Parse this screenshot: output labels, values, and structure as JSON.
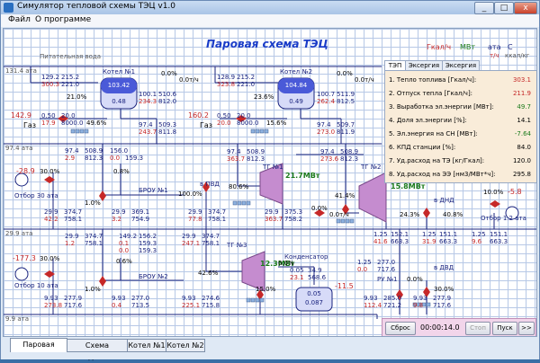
{
  "window": {
    "title": "Симулятор тепловой схемы ТЭЦ v1.0",
    "btn_min": "_",
    "btn_max": "□",
    "btn_close": "x"
  },
  "menu": {
    "file": "Файл",
    "about": "О программе"
  },
  "scheme": {
    "title": "Паровая схема ТЭЦ",
    "feedwater": "Питательная вода",
    "units": {
      "gkal": "Гкал/ч",
      "mw": "МВт",
      "ata": "ата",
      "c": "С",
      "th": "т/ч",
      "kkal": "ккал/кг"
    },
    "levels": {
      "l131": "131.4 ата",
      "l97": "97.4 ата",
      "l29": "29.9 ата",
      "l9": "9.9 ата"
    },
    "boiler1": {
      "label": "Котел №1",
      "top": "103.42",
      "bottom": "0.48",
      "pct": "21.0%",
      "pct2": "49.6%",
      "flow": "0.0т/ч",
      "flow_pct": "0.0%",
      "in_top": [
        "129.2",
        "215.2"
      ],
      "in_bot": [
        "300.3",
        "221.0"
      ],
      "out_top": [
        "100.1",
        "510.6"
      ],
      "out_bot": [
        "234.3",
        "812.0"
      ],
      "gas": [
        "0.50",
        "20.0"
      ],
      "gas2": [
        "17.9",
        "8000.0"
      ],
      "gas_label": "Газ",
      "gas_temp": "142.9",
      "st_top": [
        "97.4",
        "509.3"
      ],
      "st_bot": [
        "243.7",
        "811.8"
      ]
    },
    "boiler2": {
      "label": "Котел №2",
      "top": "104.84",
      "bottom": "0.49",
      "pct": "23.6%",
      "pct2": "15.6%",
      "flow": "0.0т/ч",
      "flow_pct": "0.0%",
      "in_top": [
        "128.9",
        "215.2"
      ],
      "in_bot": [
        "323.8",
        "221.0"
      ],
      "out_top": [
        "100.7",
        "511.9"
      ],
      "out_bot": [
        "262.4",
        "812.5"
      ],
      "gas": [
        "0.50",
        "20.0"
      ],
      "gas2": [
        "20.0",
        "8000.0"
      ],
      "gas_label": "Газ",
      "gas_temp": "160.2",
      "st_top": [
        "97.4",
        "509.7"
      ],
      "st_bot": [
        "273.0",
        "811.9"
      ]
    },
    "broy1": {
      "label": "БРОУ №1",
      "pct": "0.8%",
      "pct2": "1.0%",
      "top": [
        "97.4",
        "508.9",
        "156.0"
      ],
      "bot": [
        "2.9",
        "812.3",
        "159.3"
      ],
      "small": [
        "0.0",
        "159.3"
      ],
      "out_top": [
        "29.9",
        "369.1"
      ],
      "out_bot": [
        "3.2",
        "754.9"
      ]
    },
    "broy2": {
      "label": "БРОУ №2",
      "pct": "0.6%",
      "pct2": "1.0%",
      "top": [
        "149.2",
        "156.2"
      ],
      "bot": [
        "0.1",
        "159.3"
      ],
      "small": [
        "0.0",
        "159.3"
      ],
      "out_top": [
        "9.93",
        "277.0"
      ],
      "out_bot": [
        "0.4",
        "713.5"
      ]
    },
    "otbor30": {
      "label": "Отбор 30 ата",
      "temp": "-28.9",
      "pct": "30.0%",
      "top": [
        "29.9",
        "374.7"
      ],
      "bot": [
        "42.2",
        "758.1"
      ]
    },
    "otbor10": {
      "label": "Отбор 10 ата",
      "temp": "-177.3",
      "pct": "30.0%",
      "top": [
        "29.9",
        "374.7"
      ],
      "bot": [
        "1.2",
        "758.1"
      ],
      "out_top": [
        "9.93",
        "277.9"
      ],
      "out_bot": [
        "273.8",
        "717.6"
      ]
    },
    "tg1": {
      "label": "ТГ №1",
      "power": "21.7МВт",
      "pct": "80.6%",
      "pvd_pct": "100.0%",
      "pvd_label": "в ПВД",
      "in_top": [
        "97.4",
        "508.9"
      ],
      "in_bot": [
        "363.7",
        "812.3"
      ],
      "pvd_top": [
        "29.9",
        "374.7"
      ],
      "pvd_bot": [
        "77.8",
        "758.1"
      ],
      "out_top": [
        "29.9",
        "375.3"
      ],
      "out_bot": [
        "363.7",
        "758.2"
      ],
      "flow_pct": "0.0%",
      "flow": "0.0т/ч"
    },
    "tg2": {
      "label": "ТГ №2",
      "power": "15.8МВт",
      "pct": "41.4%",
      "pct2": "24.3%",
      "in_top": [
        "97.4",
        "508.9"
      ],
      "in_bot": [
        "273.6",
        "812.3"
      ],
      "mid_top": [
        "1.25",
        "152.1"
      ],
      "mid_bot": [
        "41.6",
        "663.3"
      ],
      "dnd_label": "в ДНД",
      "dnd_pct": "40.8%",
      "dnd_top": [
        "1.25",
        "151.1"
      ],
      "dnd_bot": [
        "31.9",
        "663.3"
      ],
      "o12_label": "Отбор 1.2 ата",
      "o12_pct": "10.0%",
      "o12_temp": "-5.8",
      "o12_top": [
        "1.25",
        "151.1"
      ],
      "o12_bot": [
        "9.6",
        "663.3"
      ]
    },
    "tg3": {
      "label": "ТГ №3",
      "power": "12.3МВт",
      "pct": "42.6%",
      "pct2": "15.0%",
      "in_top": [
        "29.9",
        "374.7"
      ],
      "in_bot": [
        "247.1",
        "758.1"
      ],
      "out_top": [
        "9.93",
        "274.6"
      ],
      "out_bot": [
        "225.1",
        "715.8"
      ],
      "kond_label": "Конденсатор",
      "kond_pct": "0.0%",
      "kond_top": [
        "0.05",
        "34.9"
      ],
      "kond_bot": [
        "23.1",
        "568.6"
      ],
      "kond_temp": "-11.5",
      "kond_box_top": "0.05",
      "kond_box_bot": "0.087"
    },
    "ru1": {
      "label": "РУ №1",
      "pct": "0.0%",
      "top": [
        "1.25",
        "277.0"
      ],
      "bot": [
        "0.0",
        "717.6"
      ],
      "in_top": [
        "9.93",
        "285.0"
      ],
      "in_bot": [
        "112.4",
        "721.2"
      ]
    },
    "dvd": {
      "label": "в ДВД",
      "pct": "30.0%",
      "top": [
        "9.93",
        "277.9"
      ],
      "bot": [
        "9.8",
        "717.6"
      ]
    }
  },
  "panel": {
    "tabs": [
      "ТЭП",
      "Эксергия",
      "Эксергия"
    ],
    "rows": [
      {
        "label": "1. Тепло топлива [Гкал/ч]:",
        "value": "303.1",
        "color": "#c62828"
      },
      {
        "label": "2. Отпуск тепла [Гкал/ч]:",
        "value": "211.9",
        "color": "#c62828"
      },
      {
        "label": "3. Выработка эл.энергии [МВт]:",
        "value": "49.7",
        "color": "#1b7a1b"
      },
      {
        "label": "4. Доля эл.энергии [%]:",
        "value": "14.1",
        "color": "#000000"
      },
      {
        "label": "5. Эл.энергия на СН [МВт]:",
        "value": "-7.64",
        "color": "#1b7a1b"
      },
      {
        "label": "6. КПД станции [%]:",
        "value": "84.0",
        "color": "#000000"
      },
      {
        "label": "7. Уд.расход на ТЭ [кг/Гкал]:",
        "value": "120.0",
        "color": "#000000"
      },
      {
        "label": "8. Уд.расход на ЭЭ [нм3/МВт*ч]:",
        "value": "295.8",
        "color": "#000000"
      }
    ]
  },
  "controls": {
    "reset": "Сброс",
    "timer": "00:00:14.0",
    "stop": "Стоп",
    "start": "Пуск",
    "fast": ">>"
  },
  "tabs": [
    "Паровая схема",
    "Схема конденсата",
    "Котел №1",
    "Котел №2"
  ],
  "colors": {
    "pipe": "#1a237e",
    "turbine": "#c58ccf",
    "boiler_top": "#4a5ad8",
    "boiler_bot": "#d7dbf8"
  }
}
